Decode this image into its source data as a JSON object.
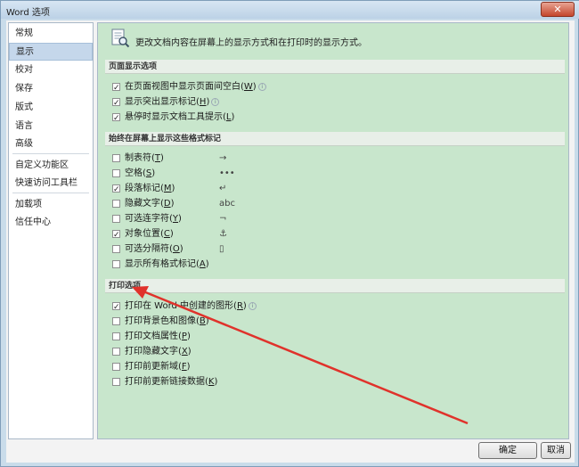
{
  "window": {
    "title": "Word 选项",
    "close_label": "✕"
  },
  "sidebar": {
    "items": [
      {
        "label": "常规",
        "selected": false
      },
      {
        "label": "显示",
        "selected": true
      },
      {
        "label": "校对",
        "selected": false
      },
      {
        "label": "保存",
        "selected": false
      },
      {
        "label": "版式",
        "selected": false
      },
      {
        "label": "语言",
        "selected": false
      },
      {
        "label": "高级",
        "selected": false
      },
      {
        "label": "自定义功能区",
        "selected": false
      },
      {
        "label": "快速访问工具栏",
        "selected": false
      },
      {
        "label": "加载项",
        "selected": false
      },
      {
        "label": "信任中心",
        "selected": false
      }
    ]
  },
  "content": {
    "intro": "更改文档内容在屏幕上的显示方式和在打印时的显示方式。",
    "page_display": {
      "heading": "页面显示选项",
      "options": [
        {
          "text": "在页面视图中显示页面间空白(",
          "key": "W",
          "tail": ")",
          "checked": true,
          "info": true
        },
        {
          "text": "显示突出显示标记(",
          "key": "H",
          "tail": ")",
          "checked": true,
          "info": true
        },
        {
          "text": "悬停时显示文档工具提示(",
          "key": "L",
          "tail": ")",
          "checked": true,
          "info": false
        }
      ]
    },
    "format_marks": {
      "heading": "始终在屏幕上显示这些格式标记",
      "options": [
        {
          "text": "制表符(",
          "key": "T",
          "tail": ")",
          "checked": false,
          "mark": "→"
        },
        {
          "text": "空格(",
          "key": "S",
          "tail": ")",
          "checked": false,
          "mark": "•••"
        },
        {
          "text": "段落标记(",
          "key": "M",
          "tail": ")",
          "checked": true,
          "mark": "↵"
        },
        {
          "text": "隐藏文字(",
          "key": "D",
          "tail": ")",
          "checked": false,
          "mark": "abc"
        },
        {
          "text": "可选连字符(",
          "key": "Y",
          "tail": ")",
          "checked": false,
          "mark": "¬"
        },
        {
          "text": "对象位置(",
          "key": "C",
          "tail": ")",
          "checked": true,
          "mark": "⚓"
        },
        {
          "text": "可选分隔符(",
          "key": "O",
          "tail": ")",
          "checked": false,
          "mark": "▯"
        },
        {
          "text": "显示所有格式标记(",
          "key": "A",
          "tail": ")",
          "checked": false,
          "mark": ""
        }
      ]
    },
    "print": {
      "heading": "打印选项",
      "options": [
        {
          "text": "打印在 Word 中创建的图形(",
          "key": "R",
          "tail": ")",
          "checked": true,
          "info": true
        },
        {
          "text": "打印背景色和图像(",
          "key": "B",
          "tail": ")",
          "checked": false,
          "info": false
        },
        {
          "text": "打印文档属性(",
          "key": "P",
          "tail": ")",
          "checked": false,
          "info": false
        },
        {
          "text": "打印隐藏文字(",
          "key": "X",
          "tail": ")",
          "checked": false,
          "info": false
        },
        {
          "text": "打印前更新域(",
          "key": "F",
          "tail": ")",
          "checked": false,
          "info": false
        },
        {
          "text": "打印前更新链接数据(",
          "key": "K",
          "tail": ")",
          "checked": false,
          "info": false
        }
      ]
    }
  },
  "footer": {
    "ok_label": "确定",
    "cancel_label": "取消"
  },
  "colors": {
    "content_bg": "#c8e6cc",
    "arrow": "#e0322b",
    "selected_nav": "#c5d7eb"
  }
}
